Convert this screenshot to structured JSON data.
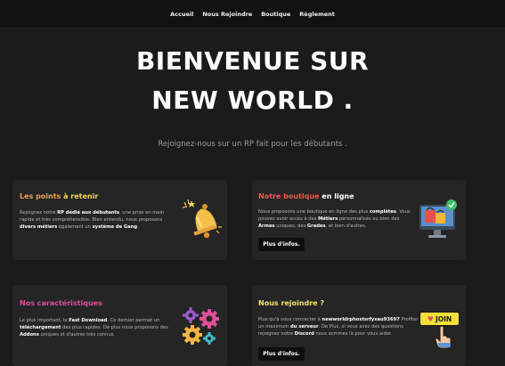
{
  "nav": {
    "items": [
      {
        "label": "Accueil"
      },
      {
        "label": "Nous Rejoindre"
      },
      {
        "label": "Boutique"
      },
      {
        "label": "Règlement"
      }
    ]
  },
  "hero": {
    "line1": "BIENVENUE SUR",
    "line2": "NEW WORLD .",
    "subtitle": "Rejoignez-nous sur un RP fait pour les débutants ."
  },
  "cards": {
    "points": {
      "title_a": "Les points ",
      "title_b": "à retenir",
      "title_color_a": "#f0a04b",
      "title_color_b": "#f5d65a",
      "t1": "Rejoignez notre ",
      "t2": "RP dédié aux débutants",
      "t3": ", une prise en main",
      "t4": "rapide et très compréhensible. Bien entendu, nous proposons",
      "t5": "divers ",
      "t6": "métiers",
      "t7": " également un ",
      "t8": "système de Gang",
      "t9": "."
    },
    "boutique": {
      "title_a": "Notre boutique ",
      "title_b": "en ligne",
      "title_color_a": "#ef5a4e",
      "title_color_b": "#ffffff",
      "t1": "Nous proposons une boutique en ligne des plus ",
      "t2": "complètes",
      "t3": ".",
      "t4": "Vous pouvez avoir accès à des ",
      "t5": "Métiers",
      "t6": " personnalisés ou bien",
      "t7": "des ",
      "t8": "Armes",
      "t9": " uniques, des ",
      "t10": "Grades",
      "t11": ", et bien d'autres.",
      "button": "Plus d'infos."
    },
    "features": {
      "title_a": "Nos caractéristiques",
      "title_color_a": "#e0509a",
      "t1": "Le plus important, le ",
      "t2": "Fast Download",
      "t3": ". Ce dernier permet un",
      "t4": "téléchargement",
      "t5": " des plus rapides. De plus nous",
      "t6": "proposons des ",
      "t7": "Addons",
      "t8": " uniques et d'autres très connus."
    },
    "join": {
      "title_a": "Nous rejoindre ?",
      "title_color_a": "#f5e56a",
      "t1": "Plus qu'à vous connecter à ",
      "t2": "newworldrphostsrfyxau93697",
      "t3": "Profiter un maximum ",
      "t4": "du serveur",
      "t5": ". De Plus, si vous avez des questions",
      "t6": "rejoignez notre ",
      "t7": "Discord",
      "t8": " nous sommes là pour vous aider.",
      "button": "Plus d'infos.",
      "badge": "JOIN"
    }
  }
}
